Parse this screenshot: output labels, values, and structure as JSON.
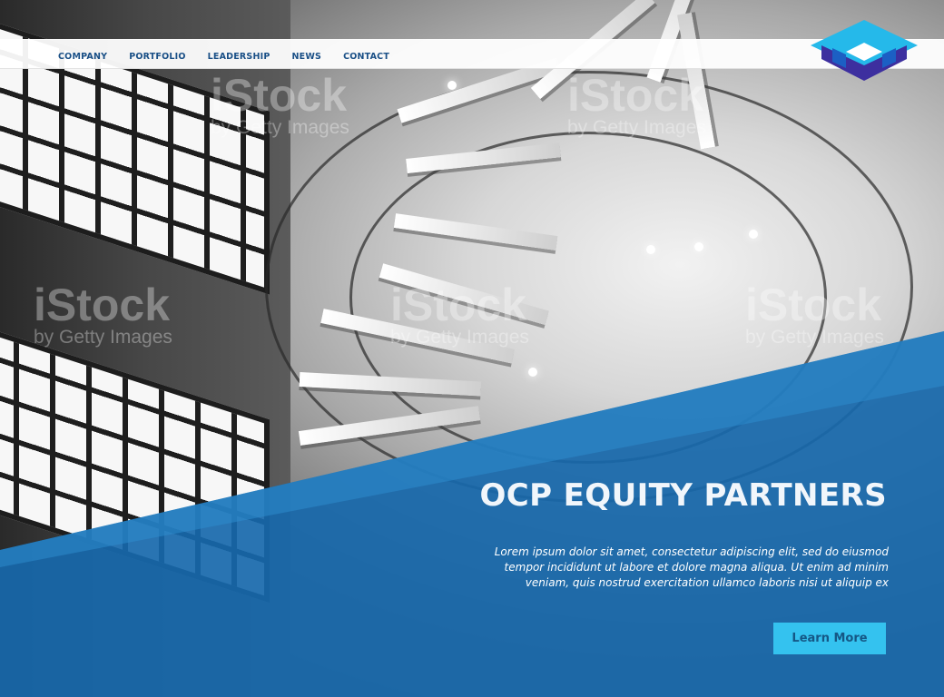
{
  "nav": {
    "items": [
      {
        "label": "COMPANY"
      },
      {
        "label": "PORTFOLIO"
      },
      {
        "label": "LEADERSHIP"
      },
      {
        "label": "NEWS"
      },
      {
        "label": "CONTACT"
      }
    ]
  },
  "hero": {
    "title": "OCP EQUITY PARTNERS",
    "description": "Lorem ipsum dolor sit amet, consectetur adipiscing elit, sed do eiusmod tempor incididunt ut labore et dolore magna aliqua. Ut enim ad minim veniam, quis nostrud exercitation ullamco laboris nisi ut aliquip ex",
    "cta_label": "Learn More"
  },
  "watermark": {
    "brand": "iStock",
    "subtitle": "by Getty Images"
  },
  "colors": {
    "nav_text": "#194f86",
    "panel_blue": "#1768ab",
    "button_cyan": "#34c2ef",
    "logo_dark": "#2c46a1",
    "logo_light": "#25b9ea"
  },
  "icons": {
    "logo": "ocp-logo-icon"
  }
}
